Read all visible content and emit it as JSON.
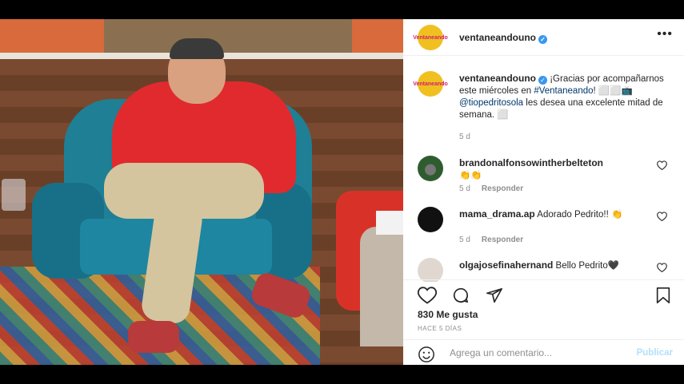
{
  "post": {
    "account": {
      "avatar_text": "Ventaneando",
      "username": "ventaneandouno",
      "verified_mark": "✓"
    },
    "more_icon": "more-horizontal-icon",
    "caption": {
      "username": "ventaneandouno",
      "text_1": " ¡Gracias por acompañarnos este miércoles en ",
      "hashtag": "#Ventaneando",
      "text_2": "! ⬜⬜📺 ",
      "mention": "@tiopedritosola",
      "text_3": " les desea una excelente mitad de semana. ⬜",
      "time": "5 d"
    },
    "comments": [
      {
        "username": "brandonalfonsowintherbelteton",
        "text": " 👏👏",
        "time": "5 d",
        "reply_label": "Responder"
      },
      {
        "username": "mama_drama.ap",
        "text": " Adorado Pedrito!! 👏",
        "time": "5 d",
        "reply_label": "Responder"
      },
      {
        "username": "olgajosefinahernand",
        "text": " Bello Pedrito🖤",
        "time": "",
        "reply_label": ""
      }
    ],
    "likes": "830 Me gusta",
    "date": "HACE 5 DÍAS",
    "comment_box": {
      "placeholder": "Agrega un comentario...",
      "post_label": "Publicar"
    },
    "colors": {
      "link": "#00376b",
      "verified": "#3897f0",
      "post_disabled": "#b2dffc"
    }
  }
}
